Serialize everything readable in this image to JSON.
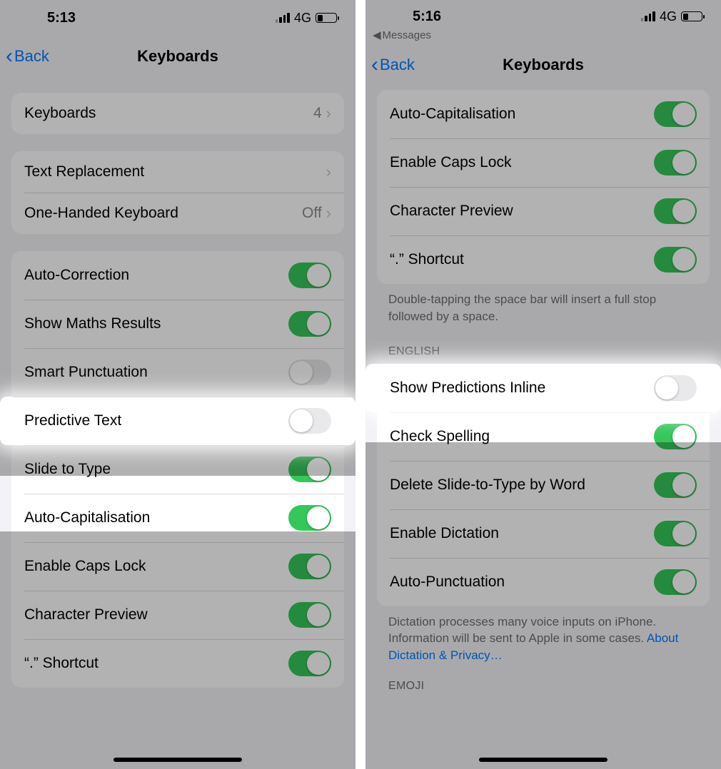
{
  "left": {
    "status": {
      "time": "5:13",
      "network": "4G"
    },
    "nav": {
      "back": "Back",
      "title": "Keyboards"
    },
    "group1": {
      "keyboards": {
        "label": "Keyboards",
        "value": "4"
      }
    },
    "group2": {
      "text_replacement": "Text Replacement",
      "one_handed": {
        "label": "One-Handed Keyboard",
        "value": "Off"
      }
    },
    "group3": {
      "auto_correction": {
        "label": "Auto-Correction",
        "on": true
      },
      "show_maths": {
        "label": "Show Maths Results",
        "on": true
      },
      "smart_punctuation": {
        "label": "Smart Punctuation",
        "on": false
      },
      "predictive_text": {
        "label": "Predictive Text",
        "on": false
      },
      "slide_to_type": {
        "label": "Slide to Type",
        "on": true
      },
      "auto_cap": {
        "label": "Auto-Capitalisation",
        "on": true
      },
      "caps_lock": {
        "label": "Enable Caps Lock",
        "on": true
      },
      "char_preview": {
        "label": "Character Preview",
        "on": true
      },
      "dot_shortcut": {
        "label": "“.” Shortcut",
        "on": true
      }
    }
  },
  "right": {
    "status": {
      "time": "5:16",
      "network": "4G"
    },
    "breadcrumb": "Messages",
    "nav": {
      "back": "Back",
      "title": "Keyboards"
    },
    "group1": {
      "auto_cap": {
        "label": "Auto-Capitalisation",
        "on": true
      },
      "caps_lock": {
        "label": "Enable Caps Lock",
        "on": true
      },
      "char_preview": {
        "label": "Character Preview",
        "on": true
      },
      "dot_shortcut": {
        "label": "“.” Shortcut",
        "on": true
      }
    },
    "footer1": "Double-tapping the space bar will insert a full stop followed by a space.",
    "section_english": "ENGLISH",
    "group2": {
      "predictions_inline": {
        "label": "Show Predictions Inline",
        "on": false
      },
      "check_spelling": {
        "label": "Check Spelling",
        "on": true
      },
      "delete_slide": {
        "label": "Delete Slide-to-Type by Word",
        "on": true
      },
      "enable_dictation": {
        "label": "Enable Dictation",
        "on": true
      },
      "auto_punctuation": {
        "label": "Auto-Punctuation",
        "on": true
      }
    },
    "footer2_a": "Dictation processes many voice inputs on iPhone. Information will be sent to Apple in some cases. ",
    "footer2_link": "About Dictation & Privacy…",
    "section_emoji": "EMOJI"
  }
}
